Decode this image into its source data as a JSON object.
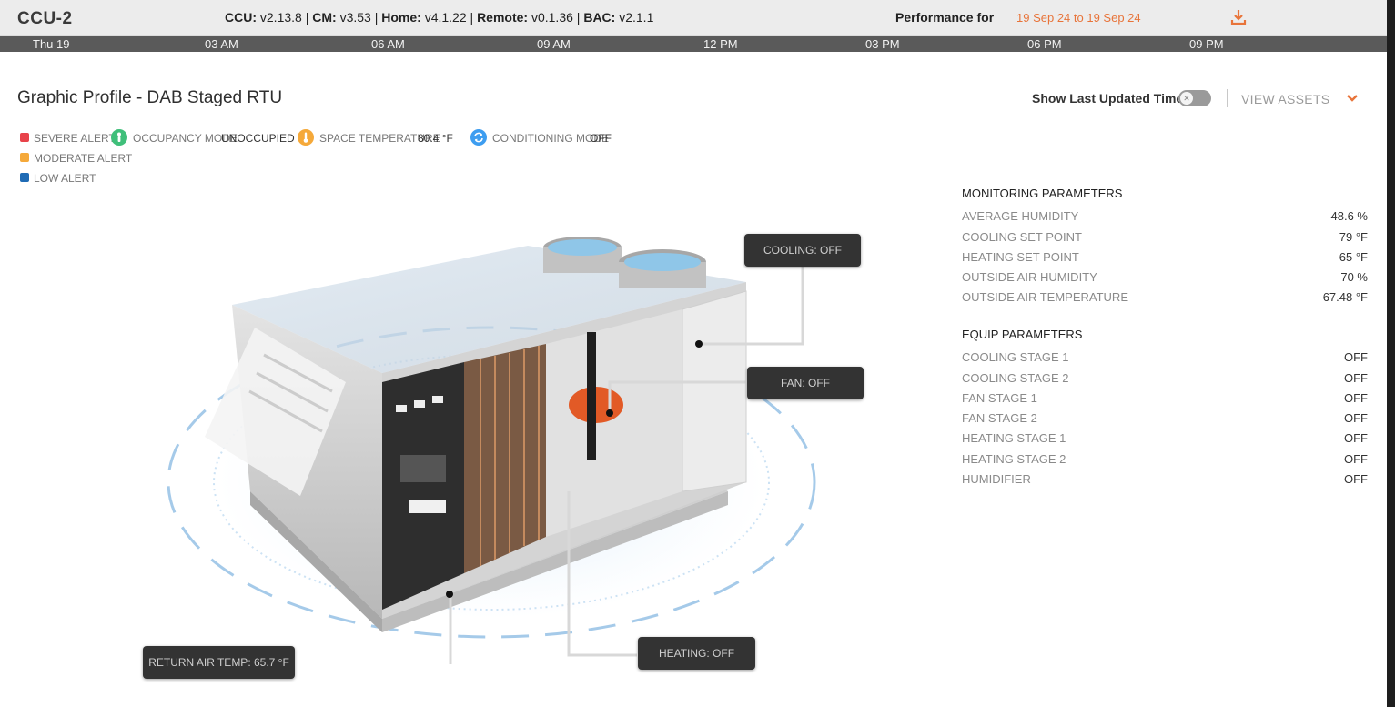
{
  "header": {
    "ccu_title": "CCU-2",
    "versions": [
      {
        "label": "CCU:",
        "value": "v2.13.8"
      },
      {
        "label": "CM:",
        "value": "v3.53"
      },
      {
        "label": "Home:",
        "value": "v4.1.22"
      },
      {
        "label": "Remote:",
        "value": "v0.1.36"
      },
      {
        "label": "BAC:",
        "value": "v2.1.1"
      }
    ],
    "performance_label": "Performance for",
    "performance_range": "19 Sep 24 to 19 Sep 24",
    "download_icon": "download-icon"
  },
  "timeline": {
    "ticks": [
      "Thu 19",
      "03 AM",
      "06 AM",
      "09 AM",
      "12 PM",
      "03 PM",
      "06 PM",
      "09 PM"
    ]
  },
  "profile": {
    "title": "Graphic Profile - DAB Staged RTU",
    "show_last_updated": "Show Last Updated Time",
    "toggle_on": false,
    "view_assets": "VIEW ASSETS"
  },
  "legend": {
    "alerts": [
      {
        "label": "SEVERE ALERT",
        "color": "#e8434a"
      },
      {
        "label": "MODERATE ALERT",
        "color": "#f5a93a"
      },
      {
        "label": "LOW ALERT",
        "color": "#1f6bb5"
      }
    ],
    "status": [
      {
        "label": "OCCUPANCY MODE",
        "value": "UNOCCUPIED",
        "color": "#3fbf7a",
        "icon": "person-icon"
      },
      {
        "label": "SPACE TEMPERATURE",
        "value": "80.4 °F",
        "color": "#f5a93a",
        "icon": "thermometer-icon"
      },
      {
        "label": "CONDITIONING MODE",
        "value": "OFF",
        "color": "#3d9df0",
        "icon": "sync-icon"
      }
    ]
  },
  "monitoring": {
    "title": "MONITORING PARAMETERS",
    "rows": [
      {
        "label": "AVERAGE HUMIDITY",
        "value": "48.6 %"
      },
      {
        "label": "COOLING SET POINT",
        "value": "79 °F"
      },
      {
        "label": "HEATING SET POINT",
        "value": "65 °F"
      },
      {
        "label": "OUTSIDE AIR HUMIDITY",
        "value": "70 %"
      },
      {
        "label": "OUTSIDE AIR TEMPERATURE",
        "value": "67.48 °F"
      }
    ]
  },
  "equip": {
    "title": "EQUIP PARAMETERS",
    "rows": [
      {
        "label": "COOLING STAGE 1",
        "value": "OFF"
      },
      {
        "label": "COOLING STAGE 2",
        "value": "OFF"
      },
      {
        "label": "FAN STAGE 1",
        "value": "OFF"
      },
      {
        "label": "FAN STAGE 2",
        "value": "OFF"
      },
      {
        "label": "HEATING STAGE 1",
        "value": "OFF"
      },
      {
        "label": "HEATING STAGE 2",
        "value": "OFF"
      },
      {
        "label": "HUMIDIFIER",
        "value": "OFF"
      }
    ]
  },
  "callouts": {
    "cooling": "COOLING: OFF",
    "fan": "FAN: OFF",
    "return_air": "RETURN AIR TEMP: 65.7 °F",
    "heating": "HEATING: OFF"
  }
}
